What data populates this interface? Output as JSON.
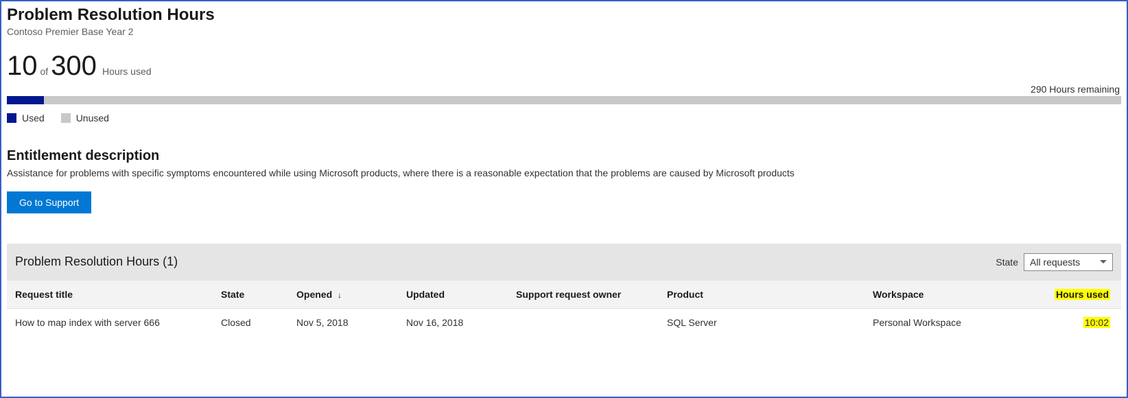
{
  "header": {
    "title": "Problem Resolution Hours",
    "subtitle": "Contoso Premier Base Year 2"
  },
  "usage": {
    "used": "10",
    "of": "of",
    "total": "300",
    "label": "Hours used",
    "remaining": "290 Hours remaining",
    "percent_used": 3.33
  },
  "legend": {
    "used": "Used",
    "unused": "Unused"
  },
  "entitlement": {
    "heading": "Entitlement description",
    "text": "Assistance for problems with specific symptoms encountered while using Microsoft products, where there is a reasonable expectation that the problems are caused by Microsoft products",
    "button": "Go to Support"
  },
  "table": {
    "title": "Problem Resolution Hours (1)",
    "state_label": "State",
    "state_selected": "All requests",
    "columns": {
      "title": "Request title",
      "state": "State",
      "opened": "Opened",
      "updated": "Updated",
      "owner": "Support request owner",
      "product": "Product",
      "workspace": "Workspace",
      "hours": "Hours used"
    },
    "sort_indicator": "↓",
    "rows": [
      {
        "title": "How to map index with server 666",
        "state": "Closed",
        "opened": "Nov 5, 2018",
        "updated": "Nov 16, 2018",
        "owner": "",
        "product": "SQL Server",
        "workspace": "Personal Workspace",
        "hours": "10:02"
      }
    ]
  },
  "colors": {
    "used": "#00188f",
    "unused": "#c8c8c8",
    "primary": "#0078d4",
    "highlight": "#ffff00"
  },
  "chart_data": {
    "type": "bar",
    "title": "Problem Resolution Hours",
    "categories": [
      "Used",
      "Unused"
    ],
    "values": [
      10,
      290
    ],
    "total": 300,
    "xlabel": "",
    "ylabel": "Hours",
    "ylim": [
      0,
      300
    ]
  }
}
